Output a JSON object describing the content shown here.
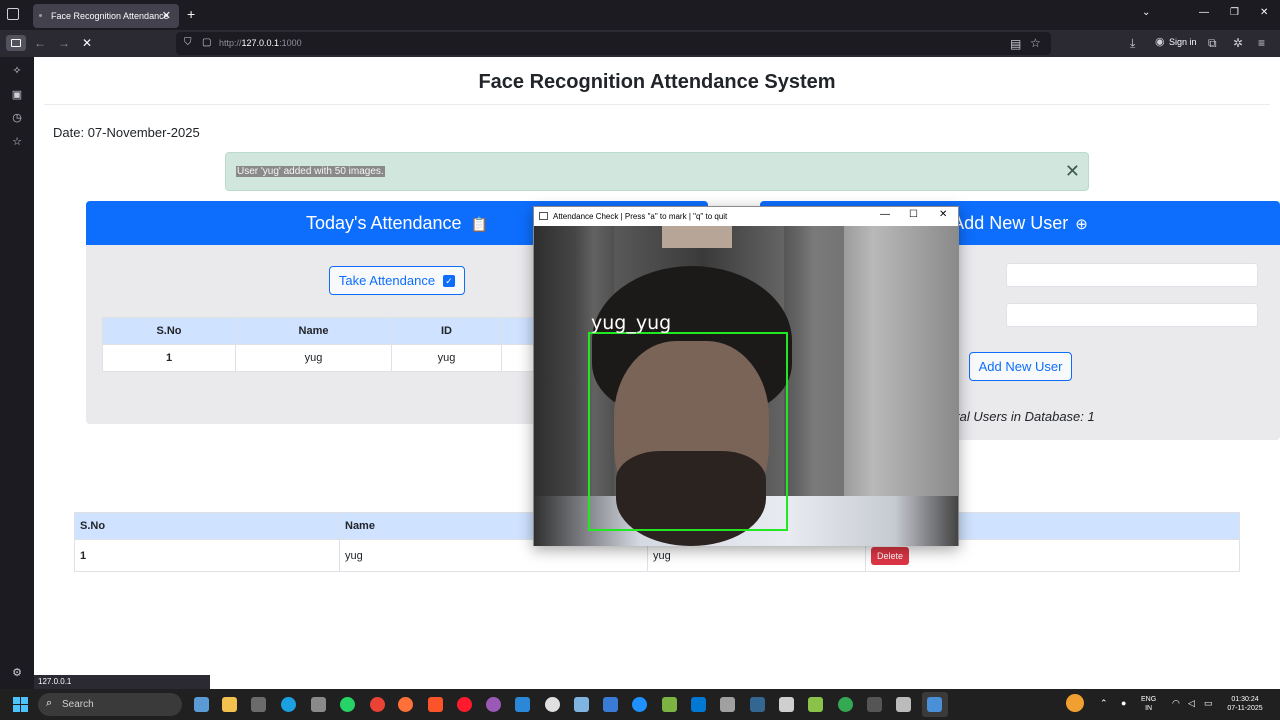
{
  "browser": {
    "tab_title": "Face Recognition Attendance",
    "tab_close": "✕",
    "new_tab": "+",
    "url_prefix": "http://",
    "url_host": "127.0.0.1",
    "url_port": ":1000",
    "sign_in": "Sign in",
    "status_url": "127.0.0.1"
  },
  "page": {
    "title": "Face Recognition Attendance System",
    "date_label": "Date:",
    "date_value": "07-November-2025",
    "alert_text": "User 'yug' added with 50 images.",
    "alert_close": "✕"
  },
  "attendance_card": {
    "title": "Today's Attendance",
    "button": "Take Attendance",
    "headers": [
      "S.No",
      "Name",
      "ID"
    ],
    "rows": [
      {
        "sno": "1",
        "name": "yug",
        "id": "yug"
      }
    ]
  },
  "new_user_card": {
    "title": "Add New User",
    "button": "Add New User",
    "total_users_text": "tal Users in Database: 1"
  },
  "users_table": {
    "headers": [
      "S.No",
      "Name"
    ],
    "rows": [
      {
        "sno": "1",
        "name": "yug",
        "id": "yug",
        "action": "Delete"
      }
    ]
  },
  "camera_window": {
    "title": "Attendance Check | Press \"a\" to mark | \"q\" to quit",
    "face_label": "yug_yug",
    "box_color": "#22e822"
  },
  "taskbar": {
    "search_placeholder": "Search",
    "lang_line1": "ENG",
    "lang_line2": "IN",
    "time": "01:30:24",
    "date": "07-11-2025"
  },
  "colors": {
    "primary": "#0d6efd",
    "danger": "#dc3545",
    "alert_bg": "#d1e7dd",
    "table_header": "#cfe2ff"
  }
}
